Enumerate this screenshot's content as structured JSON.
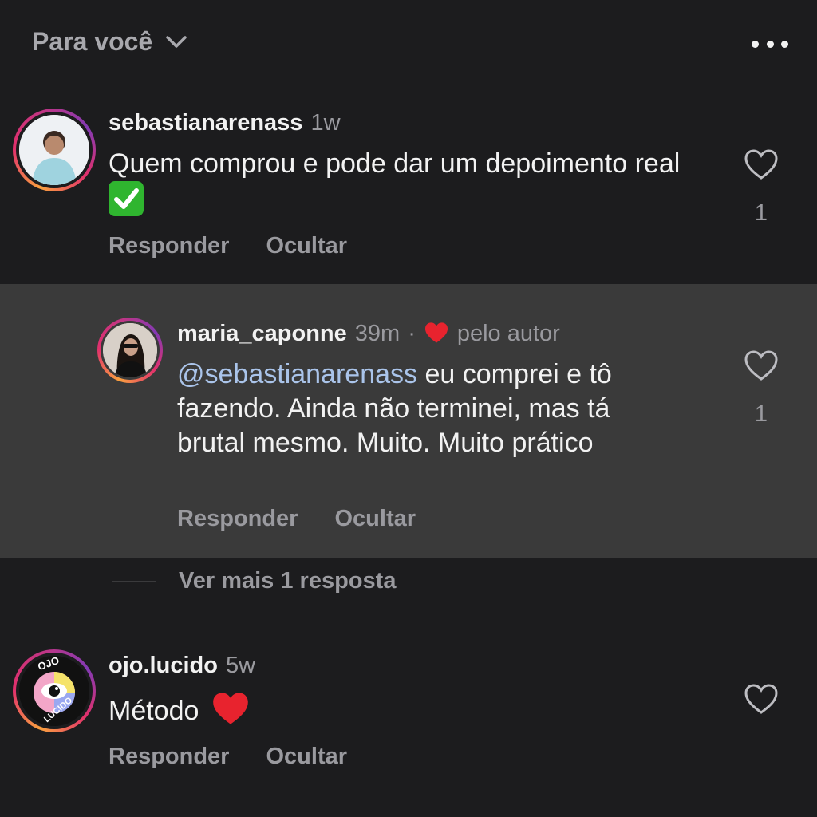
{
  "header": {
    "title": "Para você",
    "more_label": "..."
  },
  "comments": [
    {
      "username": "sebastianarenass",
      "time": "1w",
      "text": "Quem comprou e pode dar um depoimento real",
      "emoji": "check-mark-emoji",
      "likes": "1",
      "reply_label": "Responder",
      "hide_label": "Ocultar"
    },
    {
      "username": "maria_caponne",
      "time": "39m",
      "separator": "·",
      "author_badge": "pelo autor",
      "mention": "@sebastianarenass",
      "text_line1": " eu comprei e tô",
      "text_line2": "fazendo. Ainda não terminei, mas tá",
      "text_line3": "brutal mesmo. Muito. Muito prático",
      "likes": "1",
      "reply_label": "Responder",
      "hide_label": "Ocultar"
    },
    {
      "username": "ojo.lucido",
      "time": "5w",
      "text": "Método",
      "emoji": "red-heart-emoji",
      "avatar_text_top": "OJO",
      "avatar_text_bottom": "LUCIDO",
      "reply_label": "Responder",
      "hide_label": "Ocultar"
    }
  ],
  "more_replies": {
    "label": "Ver mais 1 resposta"
  },
  "colors": {
    "background": "#1c1c1e",
    "highlight": "#3a3a3a",
    "mention": "#aac4ea",
    "heart_red": "#e8232e",
    "check_green": "#2fb52f"
  }
}
